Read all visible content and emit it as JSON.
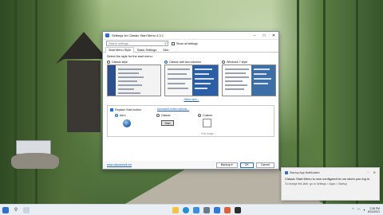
{
  "colors": {
    "accent": "#1f6fd6",
    "taskbar": "#e9eef4",
    "link": "#1b5fb5"
  },
  "window": {
    "title": "Settings for Classic Start Menu 4.3.1",
    "minimize_glyph": "–",
    "maximize_glyph": "□",
    "close_glyph": "✕",
    "search_placeholder": "Search settings",
    "show_all_label": "Show all settings",
    "show_all_checked": false,
    "tabs": [
      {
        "label": "Start Menu Style",
        "active": true
      },
      {
        "label": "Basic Settings",
        "active": false
      },
      {
        "label": "Skin",
        "active": false
      }
    ],
    "style_prompt": "Select the style for the start menu:",
    "styles": [
      {
        "label": "Classic style",
        "selected": false
      },
      {
        "label": "Classic with two columns",
        "selected": true
      },
      {
        "label": "Windows 7 style",
        "selected": false
      }
    ],
    "select_skin_link": "Select skin...",
    "replace_start_label": "Replace Start button",
    "replace_start_checked": true,
    "advanced_link": "Advanced button options...",
    "button_options": [
      {
        "label": "Aero",
        "selected": true
      },
      {
        "label": "Classic",
        "selected": false,
        "button_text": "Start"
      },
      {
        "label": "Custom",
        "selected": false,
        "pick_text": "Pick image..."
      }
    ],
    "footer_link": "www.classicshell.net",
    "backup_label": "Backup",
    "backup_caret": "▾",
    "ok_label": "OK",
    "cancel_label": "Cancel"
  },
  "toast": {
    "app": "Startup App Notification",
    "more_glyph": "···",
    "close_glyph": "✕",
    "body": "Classic Start Menu is now configured to run when you log in.",
    "sub": "To change this later, go to Settings > Apps > Startup"
  },
  "taskbar": {
    "start_icon": "windows-logo-icon",
    "apps": [
      "file-explorer-icon",
      "edge-icon",
      "store-icon",
      "settings-icon",
      "mail-icon",
      "photos-icon",
      "terminal-icon"
    ],
    "time": "2:36 PM",
    "date": "6/21/2021"
  }
}
